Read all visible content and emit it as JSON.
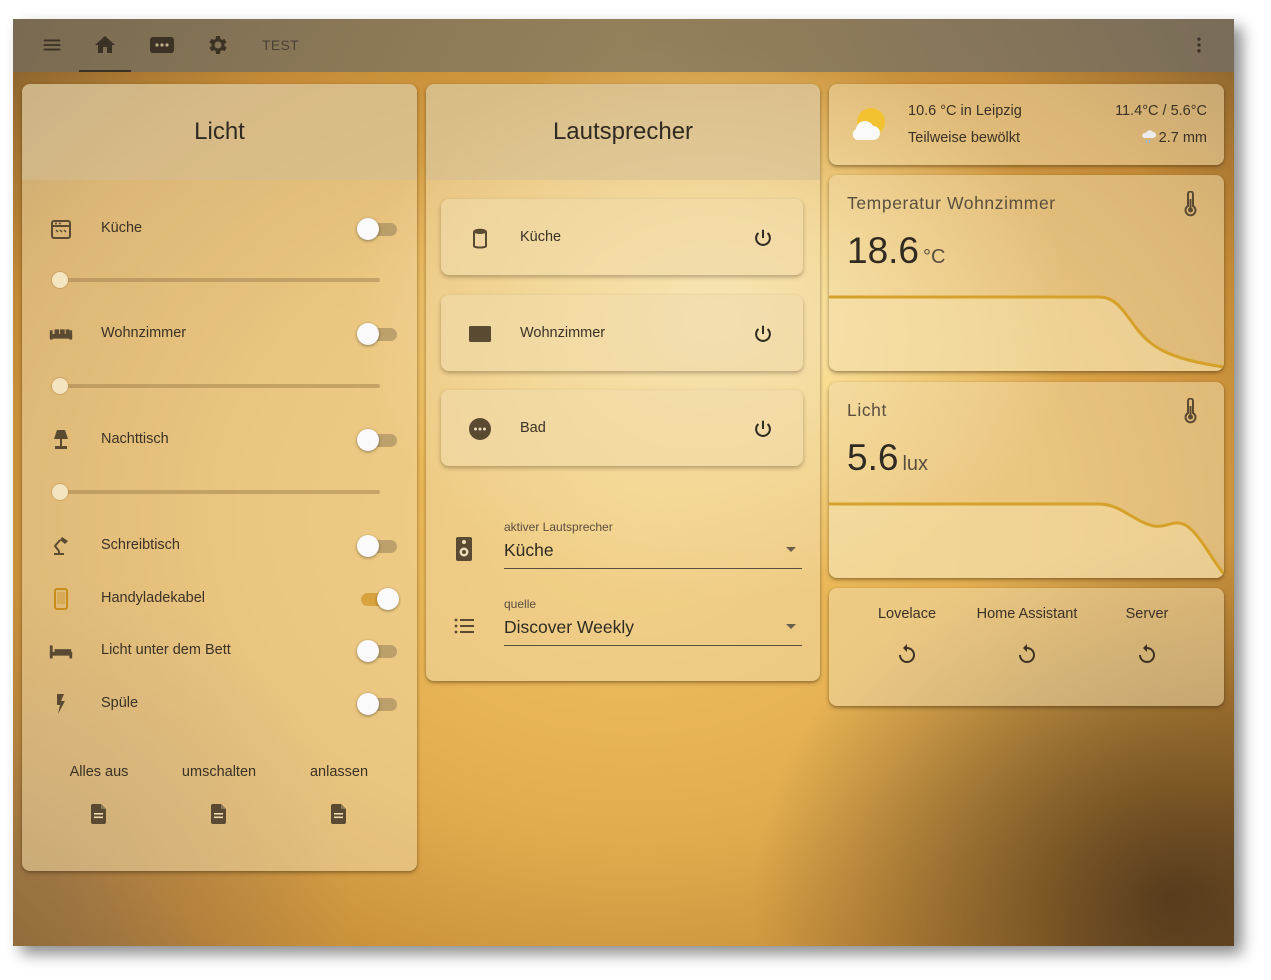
{
  "topbar": {
    "title": "TEST",
    "tabs": [
      "home-tab",
      "remote-tab",
      "settings-tab"
    ]
  },
  "licht_card": {
    "title": "Licht",
    "items": [
      {
        "label": "Küche",
        "icon": "stove-icon",
        "on": false,
        "has_slider": true,
        "brightness": 0
      },
      {
        "label": "Wohnzimmer",
        "icon": "sofa-icon",
        "on": false,
        "has_slider": true,
        "brightness": 0
      },
      {
        "label": "Nachttisch",
        "icon": "lamp-icon",
        "on": false,
        "has_slider": true,
        "brightness": 0
      },
      {
        "label": "Schreibtisch",
        "icon": "desk-lamp-icon",
        "on": false,
        "has_slider": false
      },
      {
        "label": "Handyladekabel",
        "icon": "phone-icon",
        "on": true,
        "has_slider": false
      },
      {
        "label": "Licht unter dem Bett",
        "icon": "bed-icon",
        "on": false,
        "has_slider": false
      },
      {
        "label": "Spüle",
        "icon": "flash-icon",
        "on": false,
        "has_slider": false
      }
    ],
    "actions": [
      "Alles aus",
      "umschalten",
      "anlassen"
    ]
  },
  "speaker_card": {
    "title": "Lautsprecher",
    "speakers": [
      {
        "label": "Küche",
        "icon": "google-home-icon"
      },
      {
        "label": "Wohnzimmer",
        "icon": "tv-box-icon"
      },
      {
        "label": "Bad",
        "icon": "dots-circle-icon"
      }
    ],
    "active_speaker": {
      "label": "aktiver Lautsprecher",
      "value": "Küche"
    },
    "source": {
      "label": "quelle",
      "value": "Discover Weekly"
    }
  },
  "weather": {
    "current": "10.6 °C in Leipzig",
    "condition": "Teilweise bewölkt",
    "high_low": "11.4°C / 5.6°C",
    "precipitation": "2.7 mm"
  },
  "temperature_sensor": {
    "name": "Temperatur Wohnzimmer",
    "value": "18.6",
    "unit": "°C"
  },
  "light_sensor": {
    "name": "Licht",
    "value": "5.6",
    "unit": "lux"
  },
  "services": [
    "Lovelace",
    "Home Assistant",
    "Server"
  ],
  "colors": {
    "accent": "#d9a52f",
    "graph_line": "#d6a128",
    "text": "#3a3226"
  }
}
